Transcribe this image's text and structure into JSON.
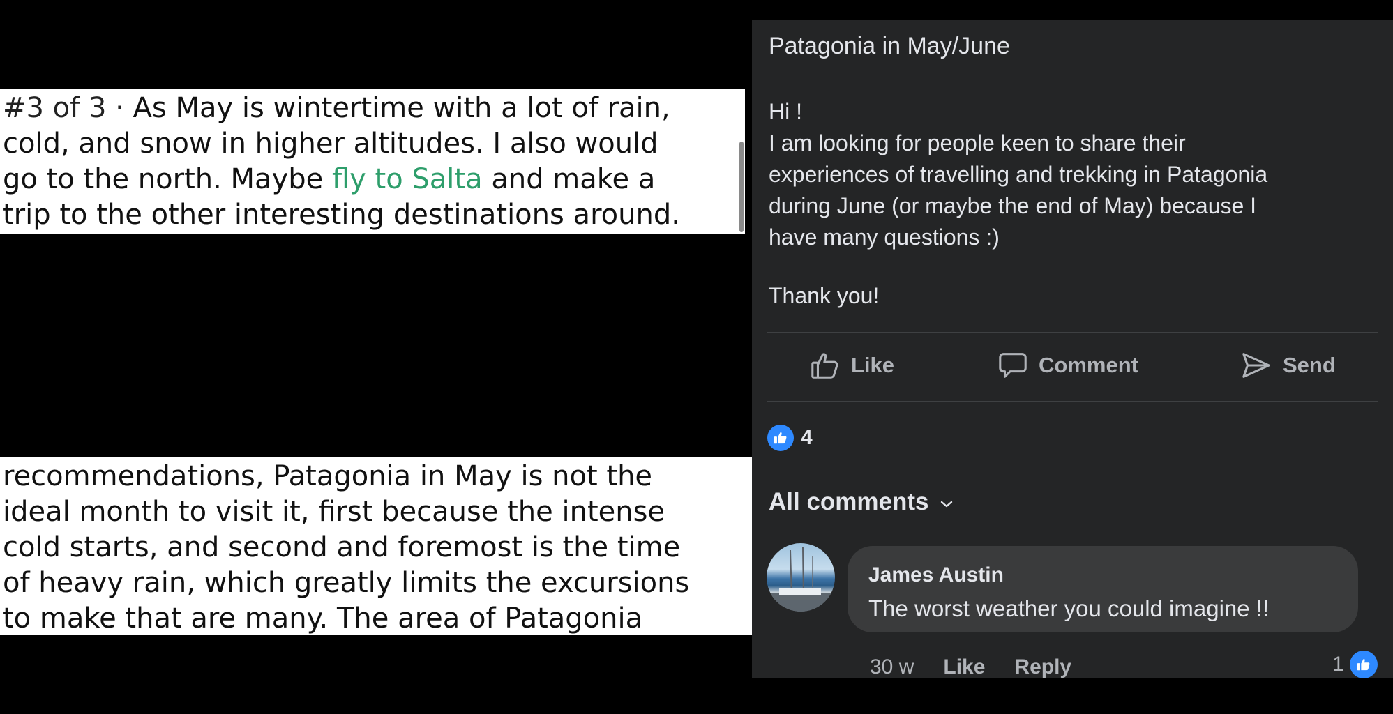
{
  "left_snippets": {
    "top": {
      "counter": "#3 of 3 ·",
      "line1_rest": " As May is wintertime with a lot of rain,",
      "line2": "cold, and snow in higher altitudes. I also would",
      "line3_before": "go to the north. Maybe ",
      "line3_link": "fly to Salta",
      "line3_after": " and make a",
      "line4": "trip to the other interesting destinations around."
    },
    "bottom": {
      "lines": [
        "recommendations, Patagonia in May is not the",
        "ideal month to visit it, first because the intense",
        "cold starts, and second and foremost is the time",
        "of heavy rain, which greatly limits the excursions",
        "to make that are many. The area of Patagonia"
      ]
    },
    "link_color": "#2e9e6b"
  },
  "post": {
    "title": "Patagonia in May/June",
    "body_lines": [
      "Hi !",
      "I am looking for people keen to share their",
      "experiences of travelling and trekking in Patagonia",
      "during June (or maybe the end of May) because I",
      "have many questions :)"
    ],
    "thanks": "Thank you!",
    "actions": {
      "like": "Like",
      "comment": "Comment",
      "send": "Send"
    },
    "reaction_count": "4",
    "all_comments_label": "All comments"
  },
  "comment": {
    "author": "James Austin",
    "text": "The worst weather you could imagine  !!",
    "time": "30 w",
    "like": "Like",
    "reply": "Reply",
    "reaction_count": "1"
  },
  "colors": {
    "panel_bg": "#242526",
    "bubble_bg": "#3a3b3c",
    "accent_blue": "#2e89ff",
    "muted_text": "#b0b3b8"
  },
  "icons": {
    "like": "thumbs-up-outline-icon",
    "comment": "speech-bubble-icon",
    "send": "paper-plane-icon",
    "reaction": "blue-thumbs-up-badge-icon",
    "dropdown": "chevron-down-icon"
  }
}
